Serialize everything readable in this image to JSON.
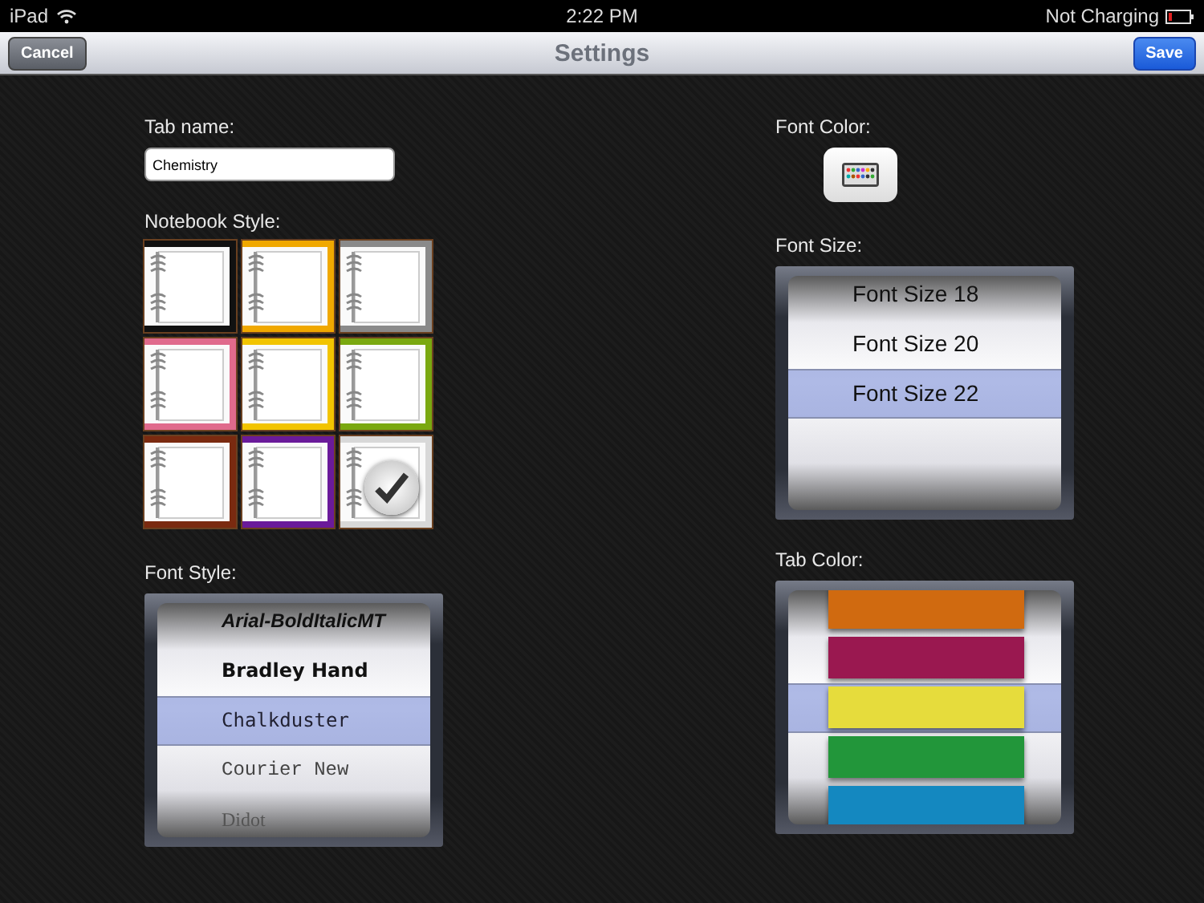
{
  "status_bar": {
    "device": "iPad",
    "time": "2:22 PM",
    "battery_text": "Not Charging"
  },
  "nav_bar": {
    "cancel": "Cancel",
    "title": "Settings",
    "save": "Save"
  },
  "tab_name": {
    "label": "Tab name:",
    "value": "Chemistry"
  },
  "notebook_style": {
    "label": "Notebook Style:",
    "styles": [
      {
        "color": "#111111",
        "selected": false
      },
      {
        "color": "#f0a800",
        "selected": false
      },
      {
        "color": "#8a8a8a",
        "selected": false
      },
      {
        "color": "#e06a8c",
        "selected": false
      },
      {
        "color": "#f2c400",
        "selected": false
      },
      {
        "color": "#7aa810",
        "selected": false
      },
      {
        "color": "#7a2a10",
        "selected": false
      },
      {
        "color": "#6a1a9a",
        "selected": false
      },
      {
        "color": "#d8d8d8",
        "selected": true
      }
    ]
  },
  "font_style": {
    "label": "Font Style:",
    "items": [
      {
        "text": "Arial-BoldItalicMT",
        "kind": "bolditalic",
        "selected": false
      },
      {
        "text": "Bradley Hand",
        "kind": "bold",
        "selected": false
      },
      {
        "text": "Chalkduster",
        "kind": "script",
        "selected": true
      },
      {
        "text": "Courier New",
        "kind": "mono",
        "selected": false
      },
      {
        "text": "Didot",
        "kind": "serif",
        "selected": false
      }
    ]
  },
  "font_color": {
    "label": "Font Color:"
  },
  "font_size": {
    "label": "Font Size:",
    "items": [
      {
        "text": "Font Size 18",
        "selected": false
      },
      {
        "text": "Font Size 20",
        "selected": false
      },
      {
        "text": "Font Size 22",
        "selected": true
      }
    ]
  },
  "tab_color": {
    "label": "Tab Color:",
    "items": [
      {
        "color": "#d06a10",
        "selected": false
      },
      {
        "color": "#9a1850",
        "selected": false
      },
      {
        "color": "#e6dc3c",
        "selected": true
      },
      {
        "color": "#22963a",
        "selected": false
      },
      {
        "color": "#1488c0",
        "selected": false
      }
    ]
  }
}
